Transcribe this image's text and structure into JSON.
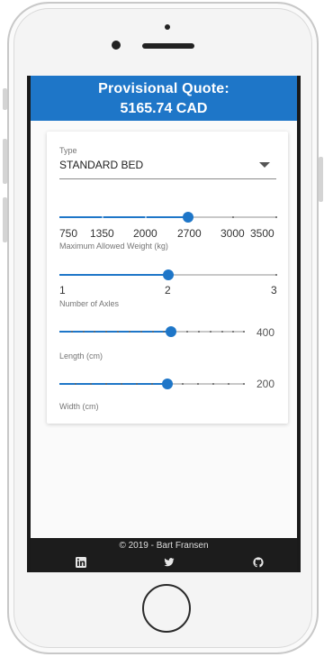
{
  "header": {
    "title": "Provisional Quote:",
    "price": "5165.74 CAD"
  },
  "form": {
    "type_select": {
      "label": "Type",
      "value": "STANDARD BED"
    },
    "weight_slider": {
      "caption": "Maximum Allowed Weight (kg)",
      "value": 2700,
      "tick_labels": [
        "750",
        "1350",
        "2000",
        "2700",
        "3000",
        "3500"
      ]
    },
    "axles_slider": {
      "caption": "Number of Axles",
      "value": 2,
      "tick_labels": [
        "1",
        "2",
        "3"
      ]
    },
    "length_slider": {
      "caption": "Length (cm)",
      "value": "400"
    },
    "width_slider": {
      "caption": "Width (cm)",
      "value": "200"
    }
  },
  "footer": {
    "copyright": "© 2019 - Bart Fransen",
    "icons": [
      "linkedin-icon",
      "twitter-icon",
      "github-icon"
    ]
  },
  "colors": {
    "primary": "#1e76c8",
    "footer_bg": "#1c1c1c",
    "page_bg": "#fafafa"
  }
}
